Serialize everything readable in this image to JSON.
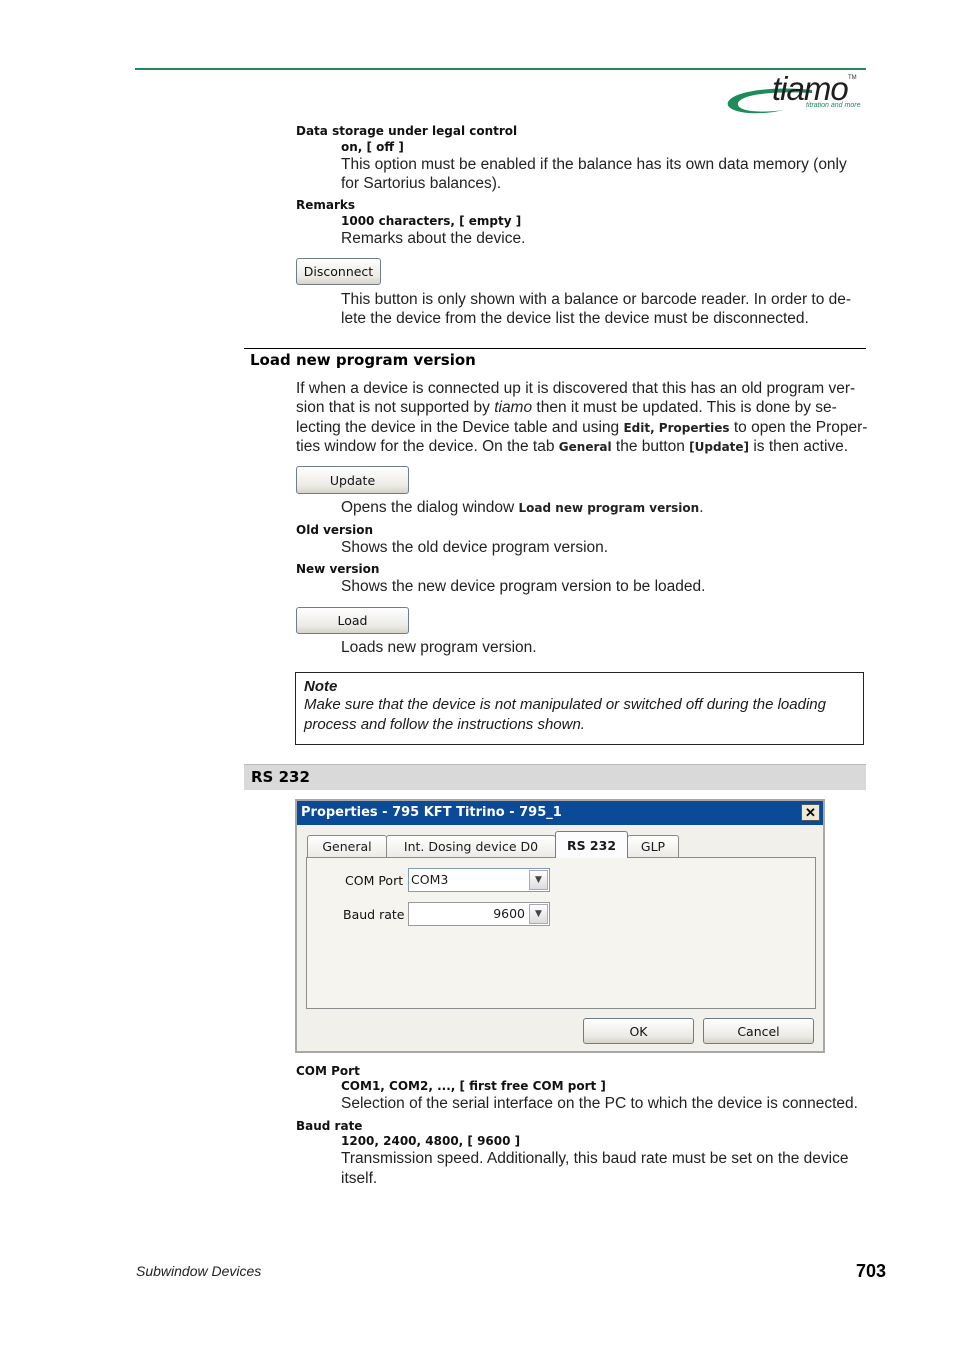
{
  "header": {
    "logo_word": "tiamo",
    "logo_tm": "TM",
    "logo_tagline": "titration and more",
    "brand_color": "#1f8a5a"
  },
  "params_top": [
    {
      "label": "Data storage under legal control",
      "values": "on, [ off ]",
      "desc_line1": "This option must be enabled if the balance has its own data memory (only",
      "desc_line2": "for Sartorius balances)."
    },
    {
      "label": "Remarks",
      "values": "1000 characters, [ empty ]",
      "desc_line1": "Remarks about the device."
    }
  ],
  "disconnect": {
    "button_label": "Disconnect",
    "desc_line1": "This button is only shown with a balance or barcode reader. In order to de-",
    "desc_line2": "lete the device from the device list the device must be disconnected."
  },
  "load_section": {
    "title": "Load new program version",
    "para": {
      "l1": "If when a device is connected up it is discovered that this has an old program ver-",
      "l2a": "sion that is not supported by ",
      "l2b": "tiamo",
      "l2c": " then it must be updated. This is done by se-",
      "l3a": "lecting the device in the Device table and using ",
      "l3b": "Edit, Properties",
      "l3c": " to open the Proper-",
      "l4a": "ties window for the device. On the tab ",
      "l4b": "General",
      "l4c": " the button ",
      "l4d": "[Update]",
      "l4e": " is then active."
    },
    "update_button": "Update",
    "update_desc_a": "Opens the dialog window ",
    "update_desc_b": "Load new program version",
    "update_desc_c": ".",
    "old_version_label": "Old version",
    "old_version_desc": "Shows the old device program version.",
    "new_version_label": "New version",
    "new_version_desc": "Shows the new device program version to be loaded.",
    "load_button": "Load",
    "load_desc": "Loads new program version.",
    "note_title": "Note",
    "note_l1": "Make sure that the device is not manipulated or switched off during the loading",
    "note_l2": "process and follow the instructions shown."
  },
  "rs232_section": {
    "title": "RS 232",
    "dialog": {
      "title": "Properties - 795 KFT Titrino - 795_1",
      "close_glyph": "✕",
      "tabs": [
        "General",
        "Int. Dosing device D0",
        "RS 232",
        "GLP"
      ],
      "active_tab": "RS 232",
      "com_port_label": "COM Port",
      "com_port_value": "COM3",
      "baud_rate_label": "Baud rate",
      "baud_rate_value": "9600",
      "dropdown_glyph": "▼",
      "ok": "OK",
      "cancel": "Cancel",
      "titlebar_color": "#0b4a96"
    },
    "params": [
      {
        "label": "COM Port",
        "values": "COM1, COM2, ..., [ first free COM port ]",
        "desc_line1": "Selection of the serial interface on the PC to which the device is connected."
      },
      {
        "label": "Baud rate",
        "values": "1200, 2400, 4800, [ 9600 ]",
        "desc_line1": "Transmission speed. Additionally, this baud rate must be set on the device",
        "desc_line2": "itself."
      }
    ]
  },
  "footer": {
    "chapter": "Subwindow Devices",
    "page_number": "703"
  }
}
